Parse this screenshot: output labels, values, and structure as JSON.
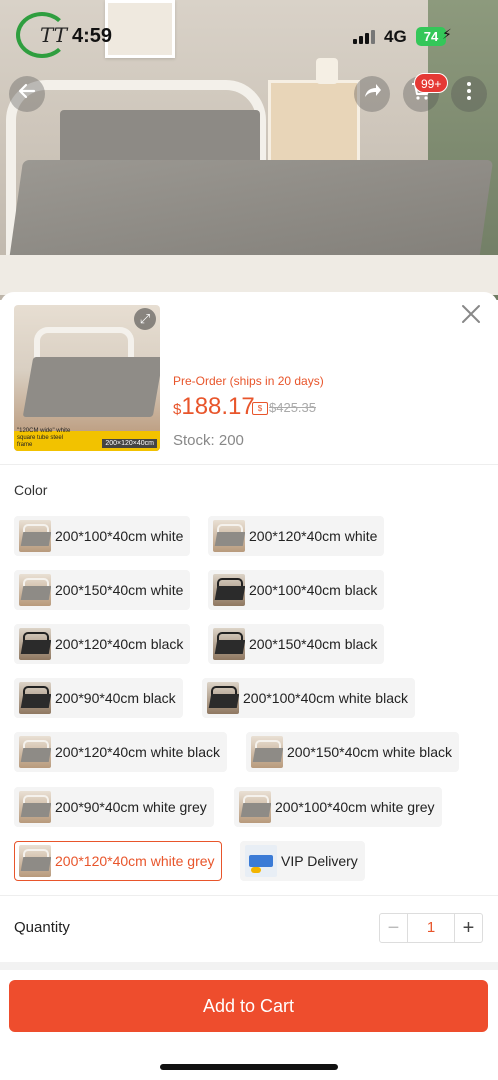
{
  "status_bar": {
    "logo_text": "TT",
    "time": "4:59",
    "network": "4G",
    "battery": "74"
  },
  "header": {
    "cart_badge": "99+"
  },
  "product": {
    "image_caption_left": "\"120CM wide\" white square tube steel frame",
    "image_caption_right": "200×120×40cm",
    "preorder": "Pre-Order (ships in 20 days)",
    "currency": "$",
    "price": "188.17",
    "old_price": "$425.35",
    "stock": "Stock: 200"
  },
  "variation": {
    "label": "Color",
    "options": [
      {
        "label": "200*100*40cm white",
        "thumb": "white"
      },
      {
        "label": "200*120*40cm white",
        "thumb": "white"
      },
      {
        "label": "200*150*40cm white",
        "thumb": "white"
      },
      {
        "label": "200*100*40cm black",
        "thumb": "black"
      },
      {
        "label": "200*120*40cm black",
        "thumb": "black"
      },
      {
        "label": "200*150*40cm black",
        "thumb": "black"
      },
      {
        "label": "200*90*40cm black",
        "thumb": "black"
      },
      {
        "label": "200*100*40cm white black",
        "thumb": "black"
      },
      {
        "label": "200*120*40cm white black",
        "thumb": "white"
      },
      {
        "label": "200*150*40cm white black",
        "thumb": "white"
      },
      {
        "label": "200*90*40cm white grey",
        "thumb": "white"
      },
      {
        "label": "200*100*40cm white grey",
        "thumb": "white"
      },
      {
        "label": "200*120*40cm white grey",
        "thumb": "white",
        "selected": true
      },
      {
        "label": "VIP Delivery",
        "thumb": "vip"
      }
    ]
  },
  "quantity": {
    "label": "Quantity",
    "minus": "−",
    "value": "1",
    "plus": "+"
  },
  "cta": {
    "add_to_cart": "Add to Cart"
  },
  "colors": {
    "accent": "#ee4d2d",
    "price": "#e8552b",
    "battery": "#34c759"
  }
}
